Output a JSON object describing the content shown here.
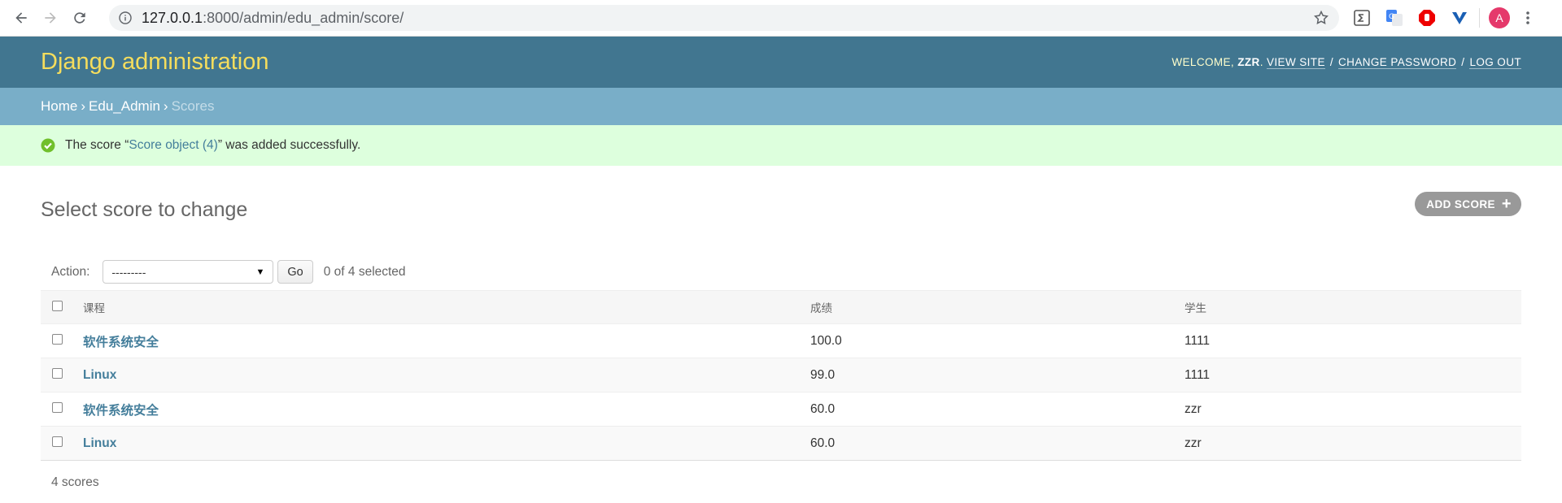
{
  "browser": {
    "url_host": "127.0.0.1",
    "url_rest": ":8000/admin/edu_admin/score/",
    "avatar_letter": "A"
  },
  "header": {
    "branding": "Django administration",
    "welcome": "Welcome,",
    "username": "zzr",
    "view_site": "View site",
    "change_password": "Change password",
    "log_out": "Log out"
  },
  "breadcrumbs": {
    "home": "Home",
    "app": "Edu_Admin",
    "current": "Scores"
  },
  "message": {
    "prefix": "The score “",
    "link": "Score object (4)",
    "suffix": "” was added successfully."
  },
  "page": {
    "title": "Select score to change",
    "add_button": "ADD SCORE"
  },
  "actions": {
    "label": "Action:",
    "selected_option": "---------",
    "go": "Go",
    "counter": "0 of 4 selected"
  },
  "table": {
    "headers": [
      "课程",
      "成绩",
      "学生"
    ],
    "rows": [
      {
        "course": "软件系统安全",
        "score": "100.0",
        "student": "1111"
      },
      {
        "course": "Linux",
        "score": "99.0",
        "student": "1111"
      },
      {
        "course": "软件系统安全",
        "score": "60.0",
        "student": "zzr"
      },
      {
        "course": "Linux",
        "score": "60.0",
        "student": "zzr"
      }
    ]
  },
  "paginator": "4 scores",
  "colors": {
    "header_bg": "#417690",
    "branding": "#f5dd5d",
    "breadcrumbs_bg": "#79aec8",
    "success_bg": "#ddffdd",
    "link": "#447e9b"
  }
}
